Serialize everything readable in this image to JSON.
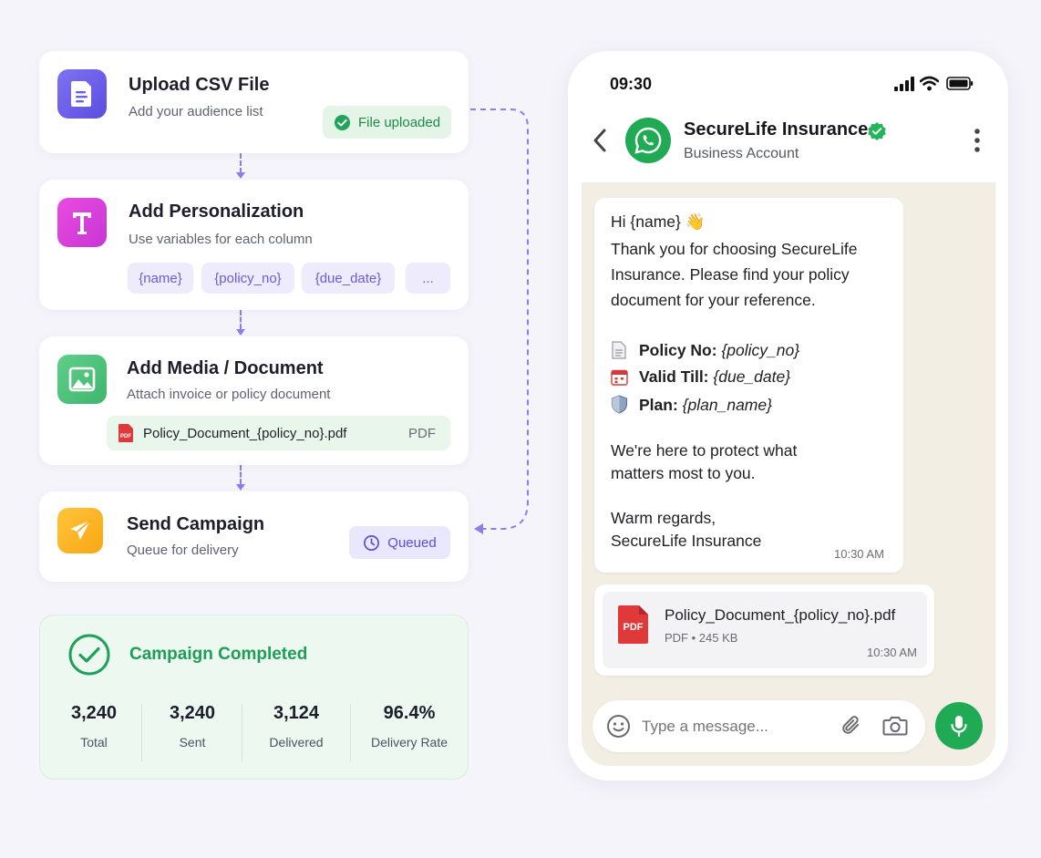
{
  "steps": {
    "upload": {
      "title": "Upload CSV File",
      "subtitle": "Add your audience list",
      "badge": "File uploaded"
    },
    "personalize": {
      "title": "Add Personalization",
      "subtitle": "Use variables for each column",
      "chips": [
        "{name}",
        "{policy_no}",
        "{due_date}",
        "..."
      ]
    },
    "media": {
      "title": "Add Media / Document",
      "subtitle": "Attach invoice or policy document",
      "file_name": "Policy_Document_{policy_no}.pdf",
      "file_type": "PDF"
    },
    "send": {
      "title": "Send Campaign",
      "subtitle": "Queue for delivery",
      "badge": "Queued"
    }
  },
  "completed": {
    "title": "Campaign Completed",
    "stats": [
      {
        "value": "3,240",
        "label": "Total"
      },
      {
        "value": "3,240",
        "label": "Sent"
      },
      {
        "value": "3,124",
        "label": "Delivered"
      },
      {
        "value": "96.4%",
        "label": "Delivery Rate"
      }
    ]
  },
  "phone": {
    "time": "09:30",
    "contact_name": "SecureLife Insurance",
    "contact_sub": "Business Account",
    "message": {
      "greeting": "Hi {name} 👋",
      "body": [
        "Thank you for choosing SecureLife",
        "Insurance. Please find your policy",
        "document for your reference."
      ],
      "details": [
        {
          "label": "Policy No:",
          "value": "{policy_no}"
        },
        {
          "label": "Valid Till:",
          "value": "{due_date}"
        },
        {
          "label": "Plan:",
          "value": "{plan_name}"
        }
      ],
      "closing": [
        "We're here to protect what",
        "matters most to you."
      ],
      "signoff": [
        "Warm regards,",
        "SecureLife Insurance"
      ],
      "time": "10:30 AM"
    },
    "attachment": {
      "name": "Policy_Document_{policy_no}.pdf",
      "meta": "PDF • 245 KB",
      "badge": "PDF",
      "time": "10:30 AM"
    },
    "input_placeholder": "Type a message..."
  },
  "colors": {
    "accent": "#7b6cf0",
    "whatsapp": "#1faa53",
    "success": "#1ea25a",
    "queued_bg": "#ebe9fc",
    "completed_bg": "#edf8f0"
  }
}
